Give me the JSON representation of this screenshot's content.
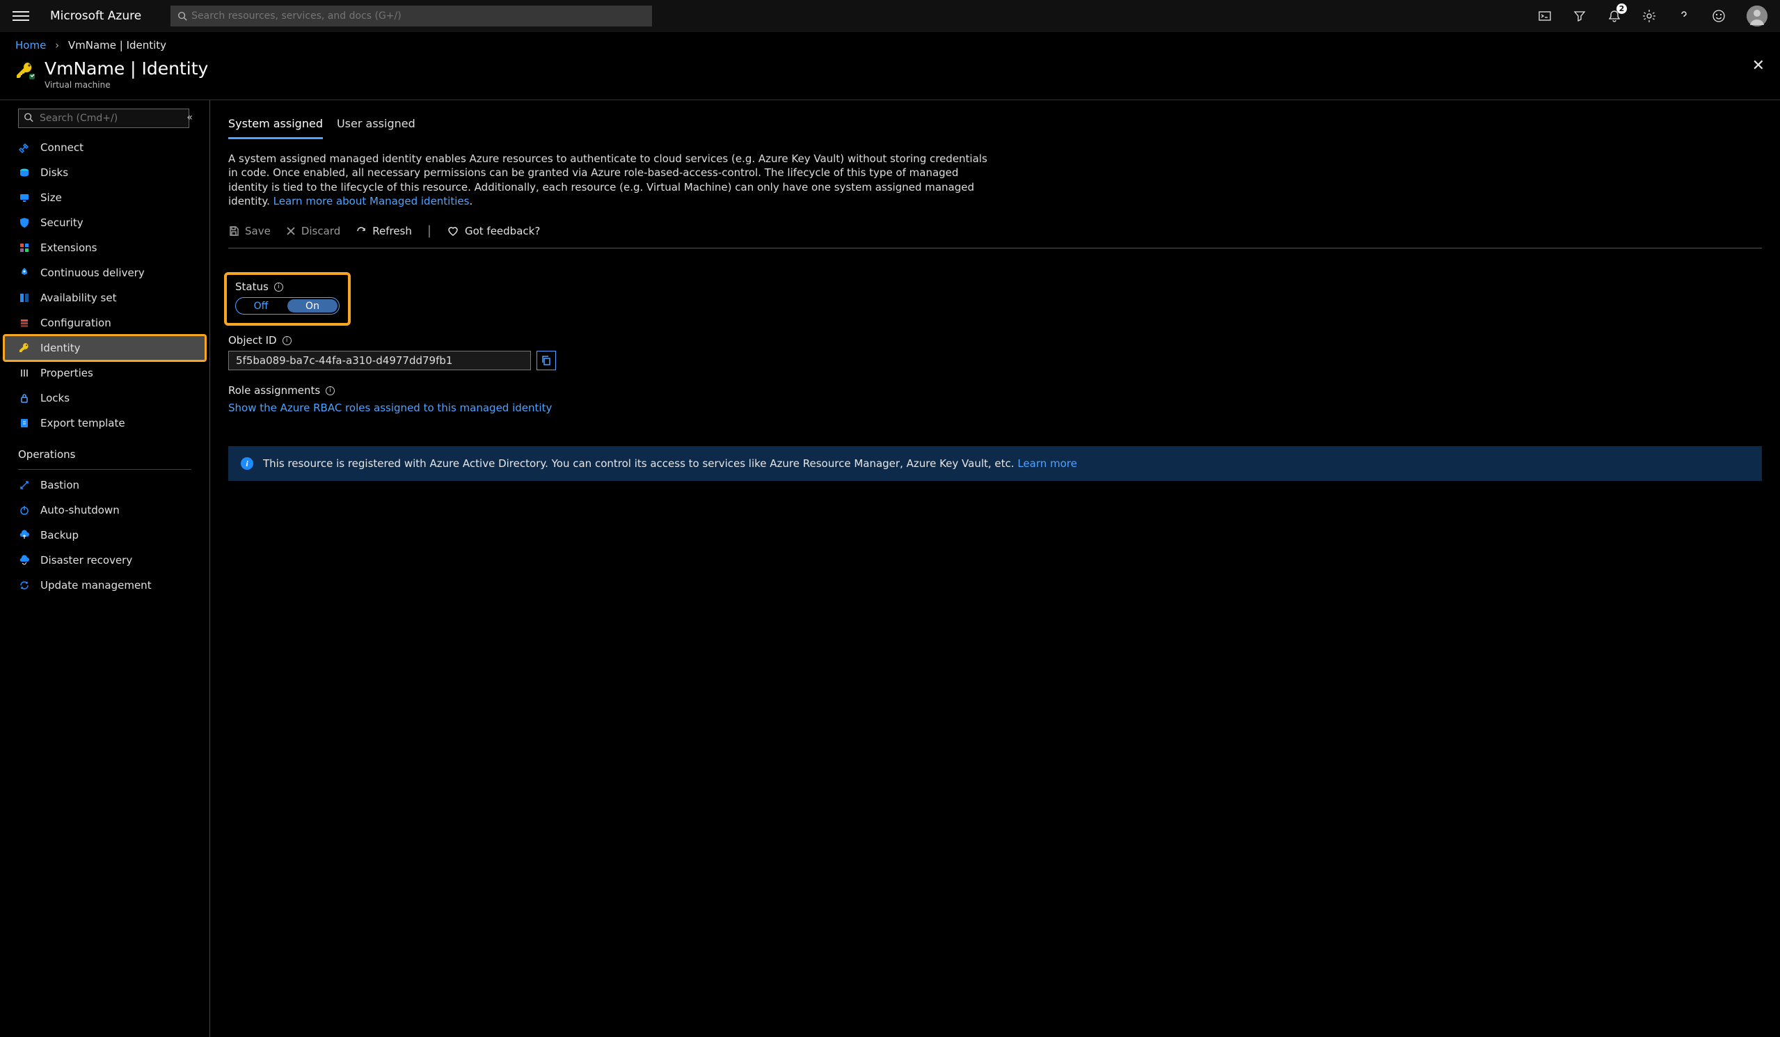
{
  "topbar": {
    "brand": "Microsoft Azure",
    "search_placeholder": "Search resources, services, and docs (G+/)",
    "notification_count": "2"
  },
  "breadcrumb": {
    "home": "Home",
    "current": "VmName | Identity"
  },
  "title": {
    "heading": "VmName | Identity",
    "subtitle": "Virtual machine"
  },
  "sidebar": {
    "search_placeholder": "Search (Cmd+/)",
    "items": [
      {
        "label": "Connect"
      },
      {
        "label": "Disks"
      },
      {
        "label": "Size"
      },
      {
        "label": "Security"
      },
      {
        "label": "Extensions"
      },
      {
        "label": "Continuous delivery"
      },
      {
        "label": "Availability set"
      },
      {
        "label": "Configuration"
      },
      {
        "label": "Identity"
      },
      {
        "label": "Properties"
      },
      {
        "label": "Locks"
      },
      {
        "label": "Export template"
      }
    ],
    "group_operations": "Operations",
    "ops_items": [
      {
        "label": "Bastion"
      },
      {
        "label": "Auto-shutdown"
      },
      {
        "label": "Backup"
      },
      {
        "label": "Disaster recovery"
      },
      {
        "label": "Update management"
      }
    ]
  },
  "main": {
    "tabs": {
      "system": "System assigned",
      "user": "User assigned"
    },
    "description": "A system assigned managed identity enables Azure resources to authenticate to cloud services (e.g. Azure Key Vault) without storing credentials in code. Once enabled, all necessary permissions can be granted via Azure role-based-access-control. The lifecycle of this type of managed identity is tied to the lifecycle of this resource. Additionally, each resource (e.g. Virtual Machine) can only have one system assigned managed identity. ",
    "description_link": "Learn more about Managed identities",
    "toolbar": {
      "save": "Save",
      "discard": "Discard",
      "refresh": "Refresh",
      "feedback": "Got feedback?"
    },
    "status": {
      "label": "Status",
      "off": "Off",
      "on": "On"
    },
    "object_id": {
      "label": "Object ID",
      "value": "5f5ba089-ba7c-44fa-a310-d4977dd79fb1"
    },
    "role_assignments": {
      "label": "Role assignments",
      "link": "Show the Azure RBAC roles assigned to this managed identity"
    },
    "banner": {
      "text": "This resource is registered with Azure Active Directory. You can control its access to services like Azure Resource Manager, Azure Key Vault, etc. ",
      "link": "Learn more"
    }
  }
}
